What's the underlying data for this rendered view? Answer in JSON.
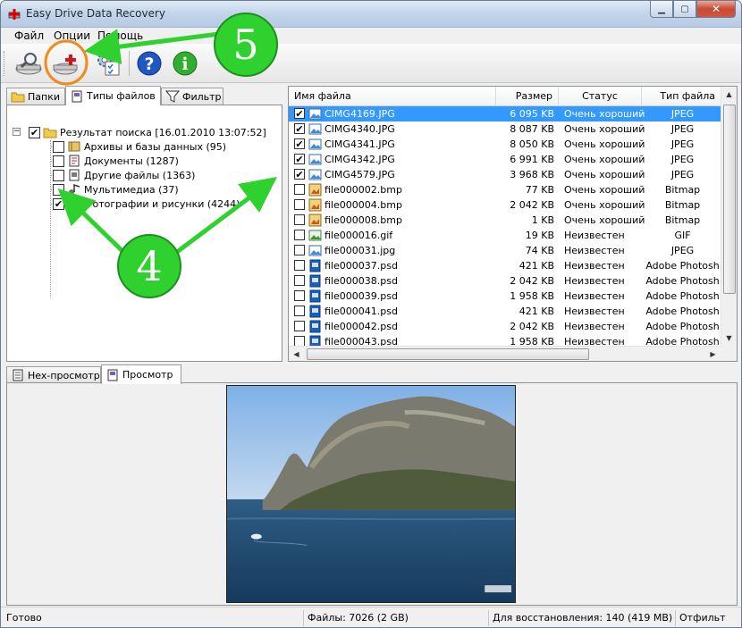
{
  "window": {
    "title": "Easy Drive Data Recovery"
  },
  "menu": [
    {
      "label": "Файл"
    },
    {
      "label": "Опции"
    },
    {
      "label": "Помощь"
    }
  ],
  "left_tabs": [
    {
      "label": "Папки"
    },
    {
      "label": "Типы файлов"
    },
    {
      "label": "Фильтр"
    }
  ],
  "tree": {
    "root": "Результат поиска [16.01.2010 13:07:52]",
    "items": [
      {
        "label": "Архивы и базы данных (95)",
        "checked": false,
        "icon": "archive-icon"
      },
      {
        "label": "Документы (1287)",
        "checked": false,
        "icon": "document-icon"
      },
      {
        "label": "Другие файлы (1363)",
        "checked": false,
        "icon": "other-files-icon"
      },
      {
        "label": "Мультимедиа (37)",
        "checked": false,
        "icon": "multimedia-icon"
      },
      {
        "label": "Фотографии и рисунки (4244)",
        "checked": true,
        "icon": "photo-icon"
      }
    ]
  },
  "file_list": {
    "columns": [
      "Имя файла",
      "Размер",
      "Статус",
      "Тип файла"
    ],
    "rows": [
      {
        "name": "CIMG4169.JPG",
        "size": "6 095 KB",
        "status": "Очень хороший",
        "type": "JPEG",
        "checked": true,
        "selected": true,
        "icon": "jpg-file-icon"
      },
      {
        "name": "CIMG4340.JPG",
        "size": "8 087 KB",
        "status": "Очень хороший",
        "type": "JPEG",
        "checked": true,
        "selected": false,
        "icon": "jpg-file-icon"
      },
      {
        "name": "CIMG4341.JPG",
        "size": "8 050 KB",
        "status": "Очень хороший",
        "type": "JPEG",
        "checked": true,
        "selected": false,
        "icon": "jpg-file-icon"
      },
      {
        "name": "CIMG4342.JPG",
        "size": "6 991 KB",
        "status": "Очень хороший",
        "type": "JPEG",
        "checked": true,
        "selected": false,
        "icon": "jpg-file-icon"
      },
      {
        "name": "CIMG4579.JPG",
        "size": "3 968 KB",
        "status": "Очень хороший",
        "type": "JPEG",
        "checked": true,
        "selected": false,
        "icon": "jpg-file-icon"
      },
      {
        "name": "file000002.bmp",
        "size": "77 KB",
        "status": "Очень хороший",
        "type": "Bitmap",
        "checked": false,
        "selected": false,
        "icon": "bmp-file-icon"
      },
      {
        "name": "file000004.bmp",
        "size": "2 042 KB",
        "status": "Очень хороший",
        "type": "Bitmap",
        "checked": false,
        "selected": false,
        "icon": "bmp-file-icon"
      },
      {
        "name": "file000008.bmp",
        "size": "1 KB",
        "status": "Очень хороший",
        "type": "Bitmap",
        "checked": false,
        "selected": false,
        "icon": "bmp-file-icon"
      },
      {
        "name": "file000016.gif",
        "size": "19 KB",
        "status": "Неизвестен",
        "type": "GIF",
        "checked": false,
        "selected": false,
        "icon": "gif-file-icon"
      },
      {
        "name": "file000031.jpg",
        "size": "74 KB",
        "status": "Неизвестен",
        "type": "JPEG",
        "checked": false,
        "selected": false,
        "icon": "jpg-file-icon"
      },
      {
        "name": "file000037.psd",
        "size": "421 KB",
        "status": "Неизвестен",
        "type": "Adobe Photosh",
        "checked": false,
        "selected": false,
        "icon": "psd-file-icon"
      },
      {
        "name": "file000038.psd",
        "size": "2 042 KB",
        "status": "Неизвестен",
        "type": "Adobe Photosh",
        "checked": false,
        "selected": false,
        "icon": "psd-file-icon"
      },
      {
        "name": "file000039.psd",
        "size": "1 958 KB",
        "status": "Неизвестен",
        "type": "Adobe Photosh",
        "checked": false,
        "selected": false,
        "icon": "psd-file-icon"
      },
      {
        "name": "file000041.psd",
        "size": "421 KB",
        "status": "Неизвестен",
        "type": "Adobe Photosh",
        "checked": false,
        "selected": false,
        "icon": "psd-file-icon"
      },
      {
        "name": "file000042.psd",
        "size": "2 042 KB",
        "status": "Неизвестен",
        "type": "Adobe Photosh",
        "checked": false,
        "selected": false,
        "icon": "psd-file-icon"
      },
      {
        "name": "file000043.psd",
        "size": "1 958 KB",
        "status": "Неизвестен",
        "type": "Adobe Photosh",
        "checked": false,
        "selected": false,
        "icon": "psd-file-icon"
      }
    ]
  },
  "bottom_tabs": [
    {
      "label": "Hex-просмотр"
    },
    {
      "label": "Просмотр"
    }
  ],
  "status": {
    "ready": "Готово",
    "files": "Файлы: 7026 (2 GB)",
    "to_recover": "Для восстановления: 140 (419 MB)",
    "filter": "Отфильт"
  },
  "annotations": [
    {
      "label": "5",
      "color": "#2fd12f"
    },
    {
      "label": "4",
      "color": "#2fd12f"
    }
  ],
  "colors": {
    "selection": "#3399ff",
    "annotation_green": "#2fd12f",
    "highlight_orange": "#f28a1c"
  }
}
